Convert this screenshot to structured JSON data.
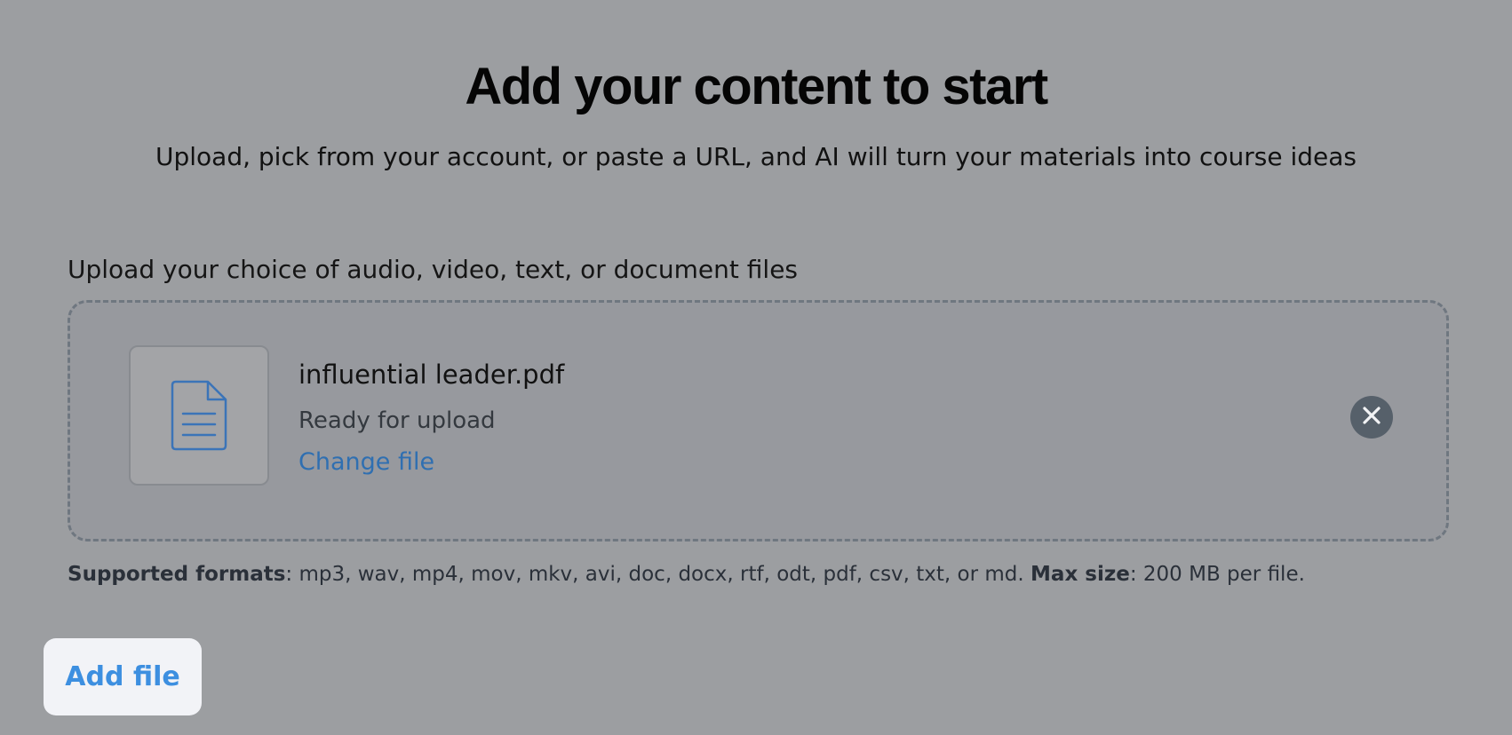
{
  "header": {
    "title": "Add your content to start",
    "subtitle": "Upload, pick from your account, or paste a URL, and AI will turn your materials into course ideas"
  },
  "upload": {
    "label": "Upload your choice of audio, video, text, or document files",
    "file": {
      "icon": "document-icon",
      "name": "influential leader.pdf",
      "status": "Ready for upload",
      "change_label": "Change file",
      "remove_icon": "close-icon"
    },
    "formats": {
      "formats_label": "Supported formats",
      "formats_value": ": mp3, wav, mp4, mov, mkv, avi, doc, docx, rtf, odt, pdf, csv, txt, or md. ",
      "size_label": "Max size",
      "size_value": ": 200 MB per file."
    }
  },
  "actions": {
    "add_file_label": "Add file"
  },
  "colors": {
    "background": "#9c9ea1",
    "link": "#2f6fb1",
    "button_text": "#3d8fe0",
    "icon_blue": "#3b74b8",
    "remove_button": "#56606a"
  }
}
